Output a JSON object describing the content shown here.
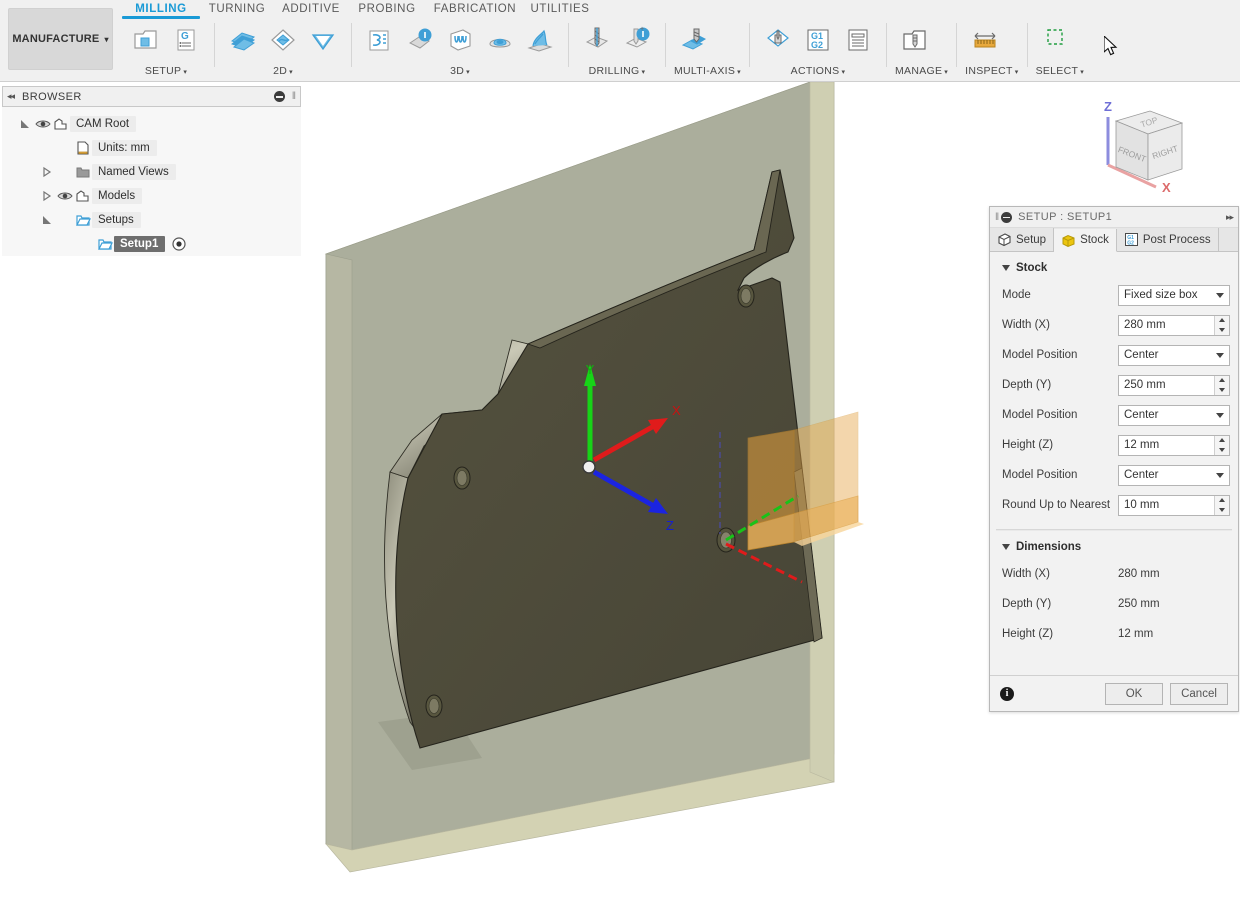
{
  "ribbon": {
    "workspace": {
      "label": "MANUFACTURE",
      "caret": "▾"
    },
    "tabs": [
      {
        "label": "MILLING",
        "active": true
      },
      {
        "label": "TURNING",
        "active": false
      },
      {
        "label": "ADDITIVE",
        "active": false
      },
      {
        "label": "PROBING",
        "active": false
      },
      {
        "label": "FABRICATION",
        "active": false
      },
      {
        "label": "UTILITIES",
        "active": false
      }
    ],
    "panels": [
      {
        "title": "SETUP",
        "caret": "▾",
        "buttons": [
          {
            "name": "new-setup-icon"
          },
          {
            "name": "ncprogram-icon"
          }
        ]
      },
      {
        "title": "2D",
        "caret": "▾",
        "buttons": [
          {
            "name": "face-icon"
          },
          {
            "name": "adaptive-2d-icon"
          },
          {
            "name": "pocket-2d-icon"
          }
        ]
      },
      {
        "title": "3D",
        "caret": "▾",
        "buttons": [
          {
            "name": "adaptive-clearing-icon"
          },
          {
            "name": "pocket-clearing-icon"
          },
          {
            "name": "parallel-icon"
          },
          {
            "name": "contour-icon"
          },
          {
            "name": "scallop-icon"
          }
        ]
      },
      {
        "title": "DRILLING",
        "caret": "▾",
        "buttons": [
          {
            "name": "drill-icon"
          },
          {
            "name": "bore-icon"
          }
        ]
      },
      {
        "title": "MULTI-AXIS",
        "caret": "▾",
        "buttons": [
          {
            "name": "multi-axis-contour-icon"
          }
        ]
      },
      {
        "title": "ACTIONS",
        "caret": "▾",
        "buttons": [
          {
            "name": "simulate-icon"
          },
          {
            "name": "post-process-icon"
          },
          {
            "name": "setup-sheet-icon"
          }
        ]
      },
      {
        "title": "MANAGE",
        "caret": "▾",
        "buttons": [
          {
            "name": "tool-library-icon"
          }
        ]
      },
      {
        "title": "INSPECT",
        "caret": "▾",
        "buttons": [
          {
            "name": "measure-icon"
          }
        ]
      },
      {
        "title": "SELECT",
        "caret": "▾",
        "buttons": [
          {
            "name": "select-window-icon"
          }
        ]
      }
    ]
  },
  "browser": {
    "header": {
      "title": "BROWSER",
      "collapse": "◂◂",
      "grip": "‖"
    },
    "tree": [
      {
        "label": "CAM Root",
        "indent": 0,
        "expander": "expanded",
        "eye": true,
        "icon": "body-icon",
        "selected": false,
        "radio": false
      },
      {
        "label": "Units: mm",
        "indent": 1,
        "expander": "none",
        "eye": false,
        "icon": "document-icon",
        "selected": false,
        "radio": false
      },
      {
        "label": "Named Views",
        "indent": 1,
        "expander": "collapsed",
        "eye": false,
        "icon": "folder-icon",
        "selected": false,
        "radio": false
      },
      {
        "label": "Models",
        "indent": 1,
        "expander": "collapsed",
        "eye": true,
        "icon": "body-icon",
        "selected": false,
        "radio": false
      },
      {
        "label": "Setups",
        "indent": 1,
        "expander": "expanded",
        "eye": false,
        "icon": "setup-icon",
        "selected": false,
        "radio": false
      },
      {
        "label": "Setup1",
        "indent": 2,
        "expander": "none",
        "eye": false,
        "icon": "setup-icon",
        "selected": true,
        "radio": true
      }
    ]
  },
  "viewcube": {
    "faces": {
      "top": "TOP",
      "front": "FRONT",
      "right": "RIGHT"
    },
    "axes": {
      "z": "Z",
      "x": "X"
    }
  },
  "viewport": {
    "triad": {
      "x": "X",
      "y": "Y",
      "z": "Z"
    },
    "colors": {
      "background": "#ffffff",
      "model": "#4d4b3e",
      "stock_face": "#abae9c",
      "stock_edge": "#d3d2b3",
      "manipulator": "#e8a33d",
      "axis_x": "#e01b1b",
      "axis_y": "#17d417",
      "axis_z": "#1b24e0"
    }
  },
  "dialog": {
    "header": {
      "title": "SETUP : SETUP1",
      "expand": "▸▸"
    },
    "tabs": [
      {
        "label": "Setup",
        "icon": "setup-tab-icon",
        "active": false
      },
      {
        "label": "Stock",
        "icon": "stock-tab-icon",
        "active": true
      },
      {
        "label": "Post Process",
        "icon": "post-process-tab-icon",
        "active": false
      }
    ],
    "stock_section": {
      "title": "Stock",
      "fields": [
        {
          "label": "Mode",
          "type": "select",
          "value": "Fixed size box"
        },
        {
          "label": "Width (X)",
          "type": "spin",
          "value": "280 mm"
        },
        {
          "label": "Model Position",
          "type": "select",
          "value": "Center"
        },
        {
          "label": "Depth (Y)",
          "type": "spin",
          "value": "250 mm"
        },
        {
          "label": "Model Position",
          "type": "select",
          "value": "Center"
        },
        {
          "label": "Height (Z)",
          "type": "spin",
          "value": "12 mm"
        },
        {
          "label": "Model Position",
          "type": "select",
          "value": "Center"
        },
        {
          "label": "Round Up to Nearest",
          "type": "spin",
          "value": "10 mm"
        }
      ]
    },
    "dimensions_section": {
      "title": "Dimensions",
      "rows": [
        {
          "label": "Width (X)",
          "value": "280 mm"
        },
        {
          "label": "Depth (Y)",
          "value": "250 mm"
        },
        {
          "label": "Height (Z)",
          "value": "12 mm"
        }
      ]
    },
    "footer": {
      "info": "i",
      "ok": "OK",
      "cancel": "Cancel"
    }
  }
}
